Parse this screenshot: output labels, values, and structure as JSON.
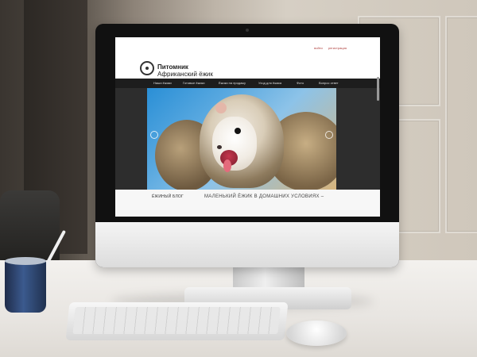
{
  "site": {
    "brand_line1": "Питомник",
    "brand_line2": "Африканский ёжик",
    "top_links": [
      "войти",
      "регистрация"
    ],
    "nav": [
      "Наши ёжики",
      "Готовые ёжики",
      "Ёжики на продажу",
      "Уход для ёжика",
      "Фото",
      "Вопрос ответ"
    ],
    "blog_label": "ЁЖИНЫЙ БЛОГ",
    "blog_title": "МАЛЕНЬКИЙ ЁЖИК В ДОМАШНИХ УСЛОВИЯХ –"
  },
  "icons": {
    "slider_prev": "chevron-left-icon",
    "slider_next": "chevron-right-icon",
    "logo": "hedgehog-logo-icon"
  },
  "colors": {
    "nav_bg": "#1d1d1d",
    "top_link_color": "#b0413e",
    "page_bg": "#ffffff"
  }
}
